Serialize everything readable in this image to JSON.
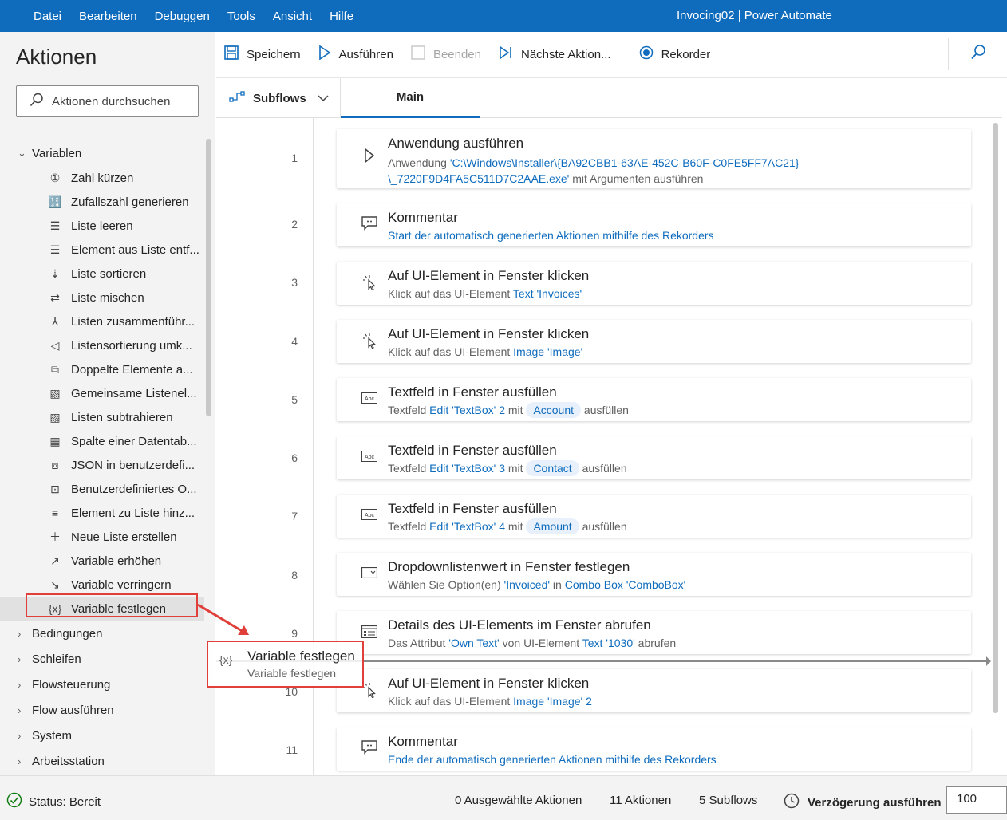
{
  "window": {
    "menu": [
      "Datei",
      "Bearbeiten",
      "Debuggen",
      "Tools",
      "Ansicht",
      "Hilfe"
    ],
    "title": "Invocing02 | Power Automate"
  },
  "actions_panel": {
    "title": "Aktionen",
    "search_placeholder": "Aktionen durchsuchen",
    "categories": [
      {
        "label": "Variablen",
        "expanded": true
      },
      {
        "label": "Bedingungen"
      },
      {
        "label": "Schleifen"
      },
      {
        "label": "Flowsteuerung"
      },
      {
        "label": "Flow ausführen"
      },
      {
        "label": "System"
      },
      {
        "label": "Arbeitsstation"
      }
    ],
    "variable_items": [
      {
        "label": "Zahl kürzen",
        "icon": "number-one-icon"
      },
      {
        "label": "Zufallszahl generieren",
        "icon": "random-number-icon"
      },
      {
        "label": "Liste leeren",
        "icon": "clear-list-icon"
      },
      {
        "label": "Element aus Liste entf...",
        "icon": "remove-item-icon"
      },
      {
        "label": "Liste sortieren",
        "icon": "sort-list-icon"
      },
      {
        "label": "Liste mischen",
        "icon": "shuffle-list-icon"
      },
      {
        "label": "Listen zusammenführ...",
        "icon": "merge-lists-icon"
      },
      {
        "label": "Listensortierung umk...",
        "icon": "reverse-list-icon"
      },
      {
        "label": "Doppelte Elemente a...",
        "icon": "duplicates-icon"
      },
      {
        "label": "Gemeinsame Listenel...",
        "icon": "common-items-icon"
      },
      {
        "label": "Listen subtrahieren",
        "icon": "subtract-lists-icon"
      },
      {
        "label": "Spalte einer Datentab...",
        "icon": "datatable-column-icon"
      },
      {
        "label": "JSON in benutzerdefi...",
        "icon": "json-convert-icon"
      },
      {
        "label": "Benutzerdefiniertes O...",
        "icon": "custom-object-icon"
      },
      {
        "label": "Element zu Liste hinz...",
        "icon": "add-to-list-icon"
      },
      {
        "label": "Neue Liste erstellen",
        "icon": "new-list-icon"
      },
      {
        "label": "Variable erhöhen",
        "icon": "increase-variable-icon"
      },
      {
        "label": "Variable verringern",
        "icon": "decrease-variable-icon"
      },
      {
        "label": "Variable festlegen",
        "icon": "set-variable-icon",
        "selected": true
      }
    ]
  },
  "toolbar": {
    "save": "Speichern",
    "run": "Ausführen",
    "stop": "Beenden",
    "next_action": "Nächste Aktion...",
    "recorder": "Rekorder"
  },
  "tabs": {
    "subflows": "Subflows",
    "main": "Main"
  },
  "flow": {
    "line_numbers": [
      "1",
      "2",
      "3",
      "4",
      "5",
      "6",
      "7",
      "8",
      "9",
      "10",
      "11"
    ],
    "steps": [
      {
        "title": "Anwendung ausführen",
        "icon": "play-icon",
        "desc1_a": "Anwendung ",
        "desc1_link": "'C:\\Windows\\Installer\\{BA92CBB1-63AE-452C-B60F-C0FE5FF7AC21}",
        "desc2_link": "\\_7220F9D4FA5C511D7C2AAE.exe'",
        "desc2_b": " mit Argumenten ausführen"
      },
      {
        "title": "Kommentar",
        "icon": "comment-icon",
        "desc_link": "Start der automatisch generierten Aktionen mithilfe des Rekorders"
      },
      {
        "title": "Auf UI-Element in Fenster klicken",
        "icon": "click-icon",
        "desc_a": "Klick auf das UI-Element ",
        "desc_link": "Text 'Invoices'"
      },
      {
        "title": "Auf UI-Element in Fenster klicken",
        "icon": "click-icon",
        "desc_a": "Klick auf das UI-Element ",
        "desc_link": "Image 'Image'"
      },
      {
        "title": "Textfeld in Fenster ausfüllen",
        "icon": "textbox-icon",
        "desc_a": "Textfeld ",
        "desc_link": "Edit 'TextBox' 2",
        "desc_b": " mit ",
        "pill": "Account",
        "desc_c": " ausfüllen"
      },
      {
        "title": "Textfeld in Fenster ausfüllen",
        "icon": "textbox-icon",
        "desc_a": "Textfeld ",
        "desc_link": "Edit 'TextBox' 3",
        "desc_b": " mit ",
        "pill": "Contact",
        "desc_c": " ausfüllen"
      },
      {
        "title": "Textfeld in Fenster ausfüllen",
        "icon": "textbox-icon",
        "desc_a": "Textfeld ",
        "desc_link": "Edit 'TextBox' 4",
        "desc_b": " mit ",
        "pill": "Amount",
        "desc_c": " ausfüllen"
      },
      {
        "title": "Dropdownlistenwert in Fenster festlegen",
        "icon": "dropdown-icon",
        "desc_a": "Wählen Sie Option(en) ",
        "desc_link": "'Invoiced'",
        "desc_b": " in ",
        "desc_link2": "Combo Box 'ComboBox'"
      },
      {
        "title": "Details des UI-Elements im Fenster abrufen",
        "icon": "details-icon",
        "desc_a": "Das Attribut ",
        "desc_link": "'Own Text'",
        "desc_b": " von UI-Element ",
        "desc_link2": "Text '1030'",
        "desc_c": " abrufen"
      },
      {
        "title": "Auf UI-Element in Fenster klicken",
        "icon": "click-icon",
        "desc_a": "Klick auf das UI-Element ",
        "desc_link": "Image 'Image' 2"
      },
      {
        "title": "Kommentar",
        "icon": "comment-icon",
        "desc_link": "Ende der automatisch generierten Aktionen mithilfe des Rekorders"
      }
    ]
  },
  "drag_preview": {
    "icon": "set-variable-icon",
    "glyph": "{x}",
    "title": "Variable festlegen",
    "subtitle": "Variable festlegen"
  },
  "statusbar": {
    "status": "Status: Bereit",
    "selected": "0 Ausgewählte Aktionen",
    "actions": "11 Aktionen",
    "subflows": "5 Subflows",
    "delay_label": "Verzögerung ausführen",
    "delay_value": "100"
  },
  "colors": {
    "accent": "#0f6cbd",
    "highlight": "#e03f3a",
    "status_ok": "#107c10"
  }
}
